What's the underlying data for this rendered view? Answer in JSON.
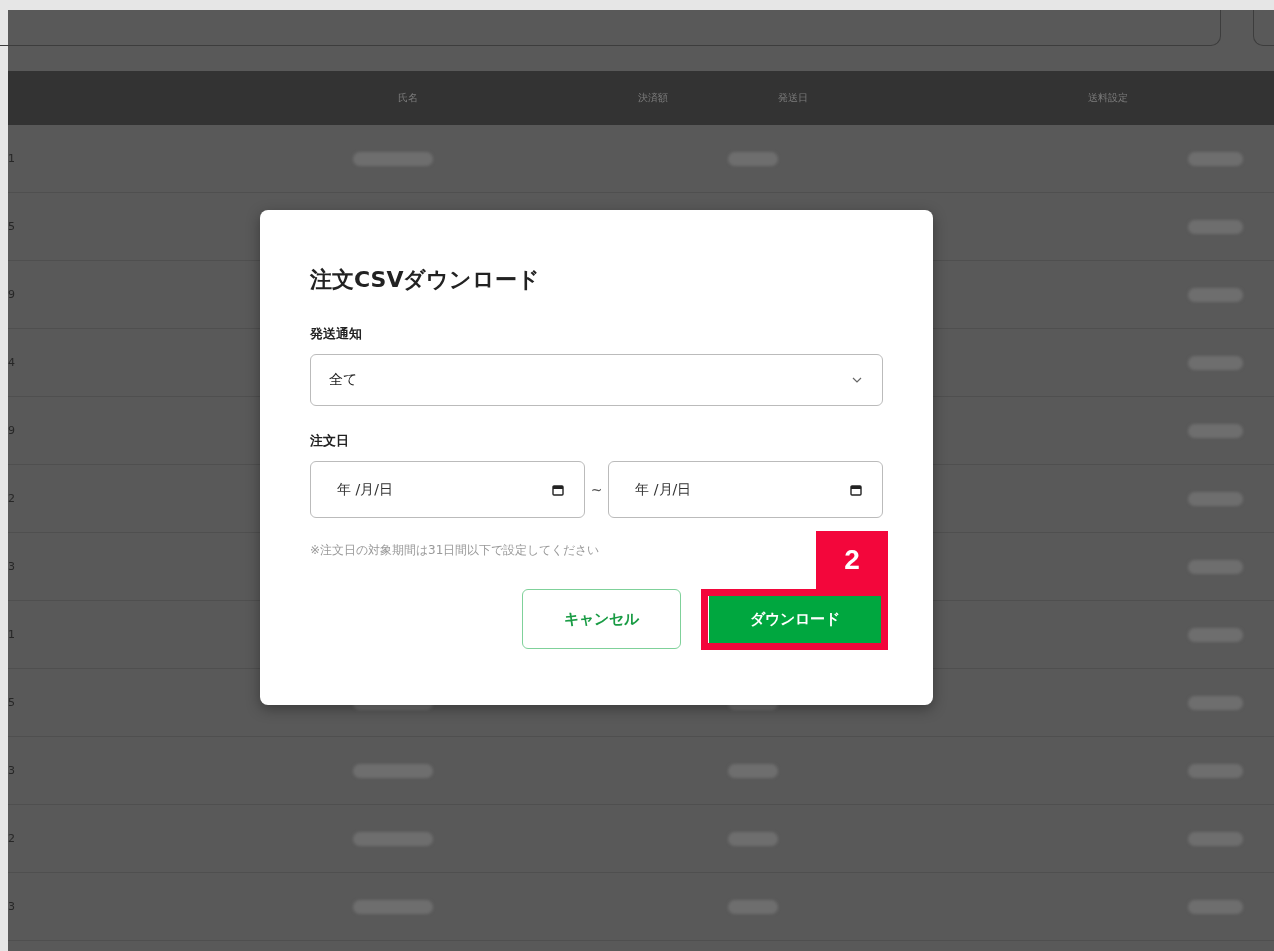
{
  "table": {
    "columns": [
      "氏名",
      "決済額",
      "発送日",
      "送料設定"
    ],
    "rows": [
      {
        "column_1": "1"
      },
      {
        "column_1": "5"
      },
      {
        "column_1": "9"
      },
      {
        "column_1": "4"
      },
      {
        "column_1": "9"
      },
      {
        "column_1": "2"
      },
      {
        "column_1": "3"
      },
      {
        "column_1": "1"
      },
      {
        "column_1": "5"
      },
      {
        "column_1": "3"
      },
      {
        "column_1": "2"
      },
      {
        "column_1": "3"
      }
    ]
  },
  "dialog": {
    "title": "注文CSVダウンロード",
    "shipping_notice": {
      "label": "発送通知",
      "value": "全て"
    },
    "order_date": {
      "label": "注文日",
      "from_placeholder": "年 /月/日",
      "separator": "~",
      "to_placeholder": "年 /月/日"
    },
    "note": "※注文日の対象期間は31日間以下で設定してください",
    "buttons": [
      {
        "kind": "secondary",
        "label": "キャンセル"
      },
      {
        "kind": "primary",
        "label": "ダウンロード"
      }
    ]
  },
  "annotation": {
    "label": "2"
  }
}
